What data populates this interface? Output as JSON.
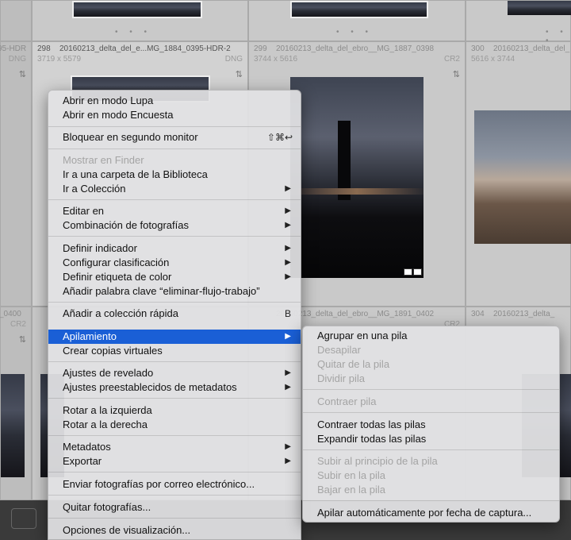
{
  "grid": {
    "row1": [
      {
        "index": "",
        "name": "95-HDR",
        "dims": "",
        "format": "DNG"
      },
      {
        "index": "298",
        "name": "20160213_delta_del_e...MG_1884_0395-HDR-2",
        "dims": "3719 x 5579",
        "format": "DNG"
      },
      {
        "index": "299",
        "name": "20160213_delta_del_ebro__MG_1887_0398",
        "dims": "3744 x 5616",
        "format": "CR2"
      },
      {
        "index": "300",
        "name": "20160213_delta_del_",
        "dims": "5616 x 3744",
        "format": ""
      }
    ],
    "row2": [
      {
        "index": "",
        "name": "_0400",
        "dims": "",
        "format": "CR2"
      },
      {
        "index": "",
        "name": "",
        "dims": "",
        "format": ""
      },
      {
        "index": "",
        "name": "20160213_delta_del_ebro__MG_1891_0402",
        "dims": "",
        "format": "CR2"
      },
      {
        "index": "304",
        "name": "20160213_delta_",
        "dims": "",
        "format": ""
      }
    ],
    "dots": "• • •",
    "filter_glyph": "⇅"
  },
  "context_menu": {
    "items": [
      {
        "label": "Abrir en modo Lupa",
        "disabled": false
      },
      {
        "label": "Abrir en modo Encuesta",
        "disabled": false
      },
      {
        "label": "Bloquear en segundo monitor",
        "shortcut": "⇧⌘↩",
        "disabled": false
      },
      {
        "label": "Mostrar en Finder",
        "disabled": true
      },
      {
        "label": "Ir a una carpeta de la Biblioteca",
        "disabled": false
      },
      {
        "label": "Ir a Colección",
        "submenu": true
      },
      {
        "label": "Editar en",
        "submenu": true
      },
      {
        "label": "Combinación de fotografías",
        "submenu": true
      },
      {
        "label": "Definir indicador",
        "submenu": true
      },
      {
        "label": "Configurar clasificación",
        "submenu": true
      },
      {
        "label": "Definir etiqueta de color",
        "submenu": true
      },
      {
        "label": "Añadir palabra clave “eliminar-flujo-trabajo”"
      },
      {
        "label": "Añadir a colección rápida",
        "shortcut": "B"
      },
      {
        "label": "Apilamiento",
        "submenu": true,
        "highlighted": true
      },
      {
        "label": "Crear copias virtuales"
      },
      {
        "label": "Ajustes de revelado",
        "submenu": true
      },
      {
        "label": "Ajustes preestablecidos de metadatos",
        "submenu": true
      },
      {
        "label": "Rotar a la izquierda"
      },
      {
        "label": "Rotar a la derecha"
      },
      {
        "label": "Metadatos",
        "submenu": true
      },
      {
        "label": "Exportar",
        "submenu": true
      },
      {
        "label": "Enviar fotografías por correo electrónico..."
      },
      {
        "label": "Quitar fotografías..."
      },
      {
        "label": "Opciones de visualización..."
      }
    ],
    "arrow_glyph": "▶"
  },
  "stacking_submenu": {
    "items": [
      {
        "label": "Agrupar en una pila",
        "disabled": false
      },
      {
        "label": "Desapilar",
        "disabled": true
      },
      {
        "label": "Quitar de la pila",
        "disabled": true
      },
      {
        "label": "Dividir pila",
        "disabled": true
      },
      {
        "label": "Contraer pila",
        "disabled": true
      },
      {
        "label": "Contraer todas las pilas",
        "disabled": false
      },
      {
        "label": "Expandir todas las pilas",
        "disabled": false
      },
      {
        "label": "Subir al principio de la pila",
        "disabled": true
      },
      {
        "label": "Subir en la pila",
        "disabled": true
      },
      {
        "label": "Bajar en la pila",
        "disabled": true
      },
      {
        "label": "Apilar automáticamente por fecha de captura...",
        "disabled": false
      }
    ]
  },
  "colors": {
    "highlight": "#1a5fd6",
    "disabled_text": "#a4a4a4"
  }
}
